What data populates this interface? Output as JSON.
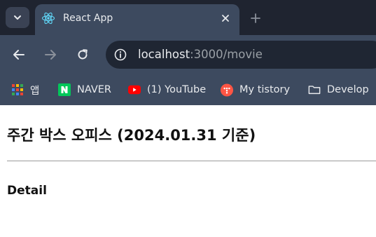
{
  "browser": {
    "tab": {
      "title": "React App"
    },
    "address": {
      "host": "localhost",
      "rest": ":3000/movie"
    },
    "bookmarks": [
      {
        "label": "앱",
        "icon": "apps-grid-icon"
      },
      {
        "label": "NAVER",
        "icon": "naver-icon"
      },
      {
        "label": "(1) YouTube",
        "icon": "youtube-icon"
      },
      {
        "label": "My tistory",
        "icon": "tistory-icon"
      },
      {
        "label": "Develop",
        "icon": "folder-icon"
      }
    ]
  },
  "page": {
    "title": "주간 박스 오피스 (2024.01.31 기준)",
    "detail_heading": "Detail"
  },
  "colors": {
    "chrome_dark": "#1f2430",
    "chrome_toolbar": "#3d4a5f",
    "naver_green": "#03c75a",
    "youtube_red": "#ff0000",
    "tistory_orange": "#ff5544",
    "react_blue": "#61dafb"
  }
}
